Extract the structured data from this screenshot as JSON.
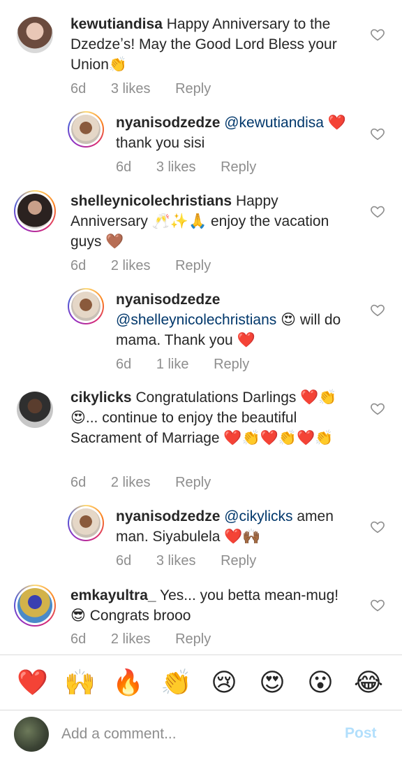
{
  "comments": [
    {
      "user": "kewutiandisa",
      "text": "Happy Anniversary to the Dzedzeʼs! May the Good Lord Bless your Union👏",
      "age": "6d",
      "likes": "3 likes",
      "reply": "Reply"
    },
    {
      "user": "nyanisodzedze",
      "mention": "@kewutiandisa",
      "text": " ❤️ thank you sisi",
      "age": "6d",
      "likes": "3 likes",
      "reply": "Reply"
    },
    {
      "user": "shelleynicolechristians",
      "text": "Happy Anniversary 🥂✨🙏 enjoy the vacation guys 🤎",
      "age": "6d",
      "likes": "2 likes",
      "reply": "Reply"
    },
    {
      "user": "nyanisodzedze",
      "mention": "@shelleynicolechristians",
      "text": " 😍 will do mama. Thank you ❤️",
      "age": "6d",
      "likes": "1 like",
      "reply": "Reply"
    },
    {
      "user": "cikylicks",
      "text": "Congratulations Darlings ❤️👏😍... continue to enjoy the beautiful Sacrament of Marriage ❤️👏❤️👏❤️👏",
      "age": "6d",
      "likes": "2 likes",
      "reply": "Reply"
    },
    {
      "user": "nyanisodzedze",
      "mention": "@cikylicks",
      "text": " amen man. Siyabulela ❤️🙌🏾",
      "age": "6d",
      "likes": "3 likes",
      "reply": "Reply"
    },
    {
      "user": "emkayultra_",
      "text": "Yes... you betta mean-mug! 😎 Congrats brooo",
      "age": "6d",
      "likes": "2 likes",
      "reply": "Reply"
    }
  ],
  "reactions": [
    "❤️",
    "🙌",
    "🔥",
    "👏",
    "😢",
    "😍",
    "😮",
    "😂"
  ],
  "composer": {
    "placeholder": "Add a comment...",
    "post_label": "Post"
  },
  "colors": {
    "mention": "#00376b",
    "meta": "#8e8e8e",
    "post_disabled": "#b2dffc"
  }
}
